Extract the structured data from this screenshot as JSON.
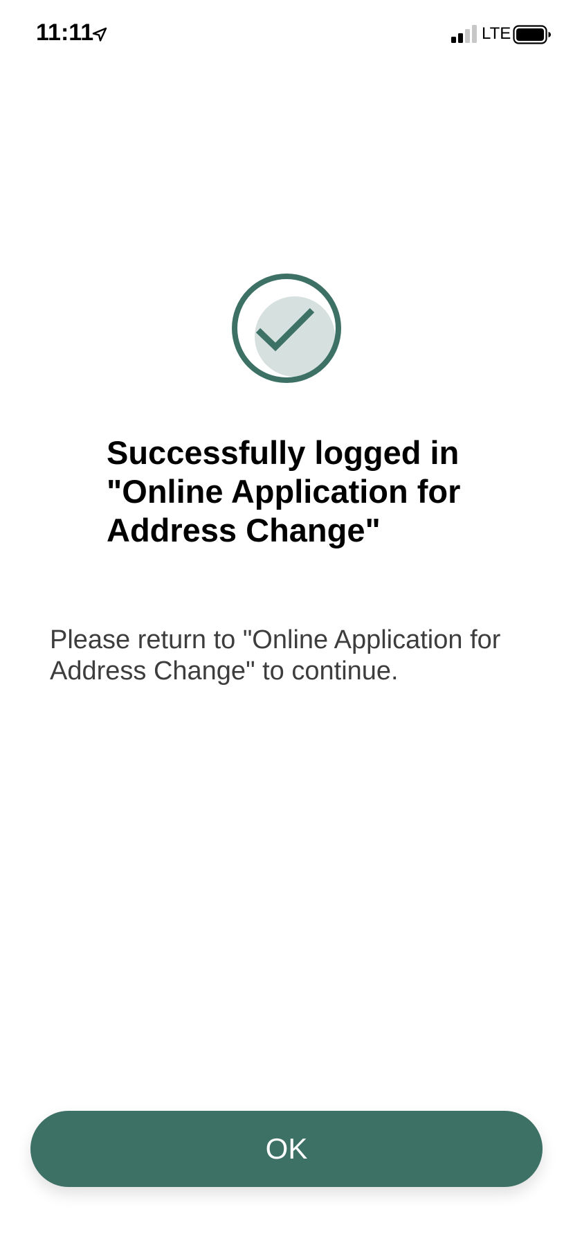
{
  "status_bar": {
    "time": "11:11",
    "network": "LTE",
    "icons": [
      "location-arrow-icon",
      "cellular-signal-icon",
      "battery-icon"
    ]
  },
  "success": {
    "icon": "check-circle-icon",
    "title": "Successfully logged in \"Online Application for Address Change\"",
    "message": "Please return to \"Online Application for Address Change\" to continue."
  },
  "actions": {
    "ok_label": "OK"
  },
  "colors": {
    "accent": "#3e7166",
    "icon_fill": "#d6e0de",
    "text_primary": "#000000",
    "text_secondary": "#3d3d3d",
    "background": "#ffffff"
  }
}
